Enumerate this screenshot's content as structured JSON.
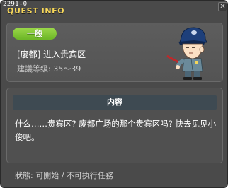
{
  "window": {
    "quest_id": "2291-0",
    "title": "QUEST INFO",
    "close_symbol": "✕"
  },
  "quest": {
    "category": "一般",
    "name": "[废都] 进入贵宾区",
    "level_requirement": "建議等级: 35～39",
    "npc_icon": "npc-police-officer"
  },
  "content": {
    "section_title": "内容",
    "text": "什么……贵宾区? 废都广场的那个贵宾区吗? 快去见见小俊吧。"
  },
  "status": {
    "text": "狀態: 可開始 / 不可执行任務"
  },
  "colors": {
    "title_yellow": "#f5d65a",
    "badge_green": "#7cc233",
    "window_bg": "#4a4a4a",
    "panel_bg": "#545454",
    "section_header_bg": "#3e4a52"
  }
}
